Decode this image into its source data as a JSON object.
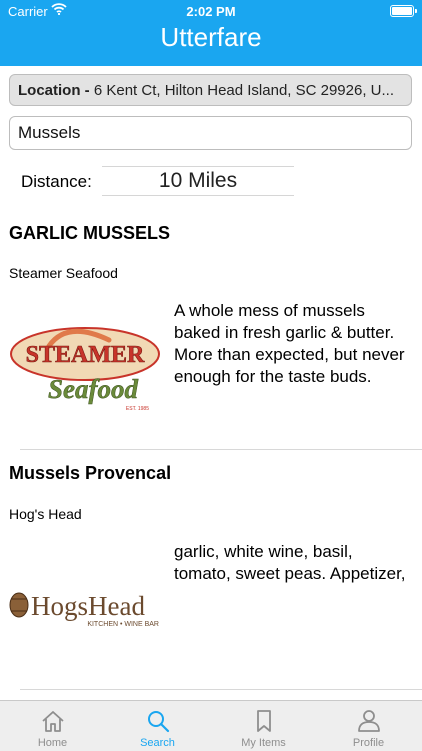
{
  "status_bar": {
    "carrier": "Carrier",
    "time": "2:02 PM"
  },
  "app_title": "Utterfare",
  "location": {
    "label": "Location -",
    "value": "6 Kent Ct, Hilton Head Island, SC 29926, U..."
  },
  "search": {
    "value": "Mussels"
  },
  "distance": {
    "label": "Distance:",
    "value": "10 Miles"
  },
  "results": [
    {
      "title": "GARLIC MUSSELS",
      "restaurant": "Steamer Seafood",
      "description": "A whole mess of mussels baked in fresh garlic & butter. More than expected, but never enough for the taste buds.",
      "logo": {
        "line1": "STEAMER",
        "line2": "Seafood",
        "small": "EST. 1985"
      }
    },
    {
      "title": "Mussels Provencal",
      "restaurant": "Hog's Head",
      "description": "garlic, white wine, basil, tomato, sweet peas. Appetizer,",
      "logo": {
        "line1": "HogsHead",
        "line2": "KITCHEN • WINE BAR"
      }
    }
  ],
  "tabs": [
    {
      "label": "Home",
      "icon": "home-icon"
    },
    {
      "label": "Search",
      "icon": "search-icon",
      "active": true
    },
    {
      "label": "My Items",
      "icon": "bookmark-icon"
    },
    {
      "label": "Profile",
      "icon": "person-icon"
    }
  ],
  "colors": {
    "accent": "#1aa6f0",
    "steamer_red": "#c8342a",
    "steamer_green": "#6a8a3a",
    "hogshead_brown": "#6b4a2e"
  }
}
